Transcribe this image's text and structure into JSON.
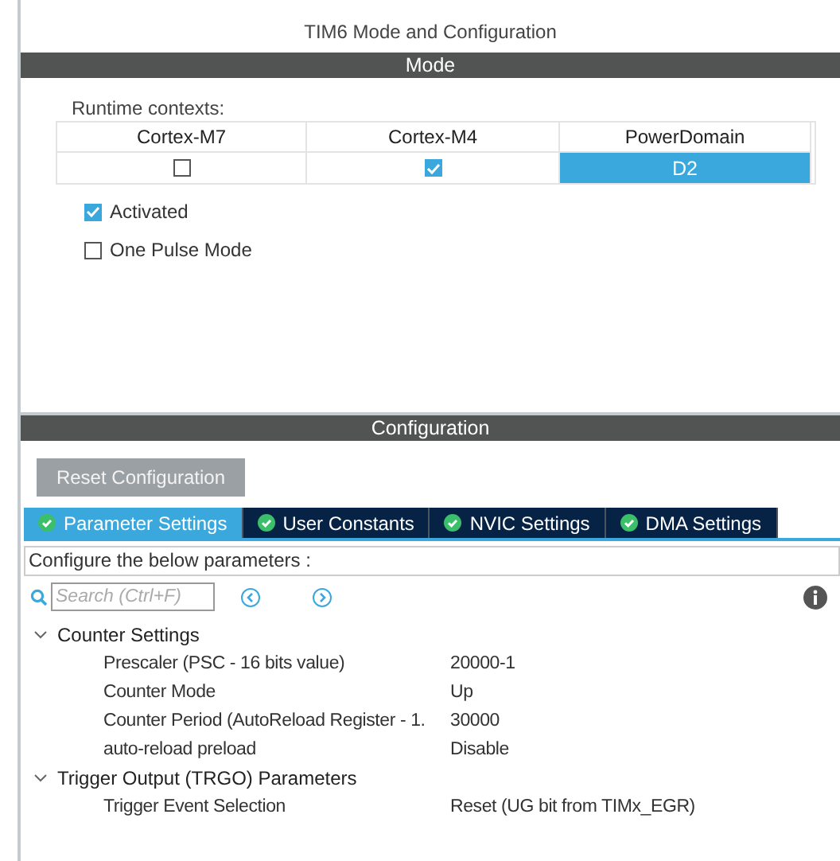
{
  "window": {
    "title": "TIM6 Mode and Configuration"
  },
  "mode": {
    "header": "Mode",
    "runtime_label": "Runtime contexts:",
    "contexts": [
      {
        "header": "Cortex-M7",
        "kind": "checkbox",
        "checked": false
      },
      {
        "header": "Cortex-M4",
        "kind": "checkbox",
        "checked": true
      },
      {
        "header": "PowerDomain",
        "kind": "value",
        "text": "D2",
        "selected": true
      }
    ],
    "options": [
      {
        "label": "Activated",
        "checked": true
      },
      {
        "label": "One Pulse Mode",
        "checked": false
      }
    ]
  },
  "configuration": {
    "header": "Configuration",
    "reset_button": "Reset Configuration",
    "tabs": [
      {
        "label": "Parameter Settings",
        "selected": true
      },
      {
        "label": "User Constants",
        "selected": false
      },
      {
        "label": "NVIC Settings",
        "selected": false
      },
      {
        "label": "DMA Settings",
        "selected": false
      }
    ],
    "hint": "Configure the below parameters :",
    "search": {
      "placeholder": "Search (Ctrl+F)"
    },
    "groups": [
      {
        "label": "Counter Settings",
        "expanded": true,
        "children": [
          {
            "name": "Prescaler (PSC - 16 bits value)",
            "value": "20000-1"
          },
          {
            "name": "Counter Mode",
            "value": "Up"
          },
          {
            "name": "Counter Period (AutoReload Register - 1.",
            "value": "30000"
          },
          {
            "name": "auto-reload preload",
            "value": "Disable"
          }
        ]
      },
      {
        "label": "Trigger Output (TRGO) Parameters",
        "expanded": true,
        "children": [
          {
            "name": "Trigger Event Selection",
            "value": "Reset (UG bit from TIMx_EGR)"
          }
        ]
      }
    ]
  }
}
